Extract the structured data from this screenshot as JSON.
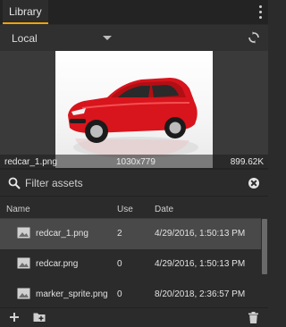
{
  "tab": {
    "title": "Library"
  },
  "source": {
    "selected": "Local"
  },
  "preview": {
    "file_name": "redcar_1.png",
    "dimensions": "1030x779",
    "file_size": "899.62K"
  },
  "filter": {
    "placeholder": "Filter assets",
    "value": ""
  },
  "table": {
    "columns": [
      "Name",
      "Use",
      "Date"
    ],
    "rows": [
      {
        "name": "redcar_1.png",
        "use": "2",
        "date": "4/29/2016, 1:50:13 PM"
      },
      {
        "name": "redcar.png",
        "use": "0",
        "date": "4/29/2016, 1:50:13 PM"
      },
      {
        "name": "marker_sprite.png",
        "use": "0",
        "date": "8/20/2018, 2:36:57 PM"
      }
    ]
  },
  "colors": {
    "accent": "#f0a30a",
    "car": "#d8141c"
  },
  "icons": {
    "menu": "more-vert-icon",
    "sync": "sync-icon",
    "search": "search-icon",
    "clear": "clear-icon",
    "image": "image-icon",
    "add": "add-icon",
    "add_folder": "add-folder-icon",
    "delete": "trash-icon"
  }
}
